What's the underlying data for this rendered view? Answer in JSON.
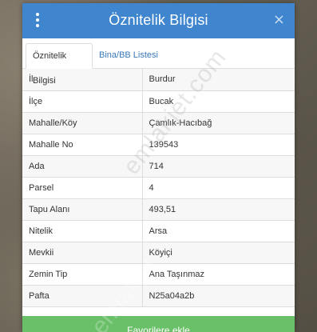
{
  "dialog": {
    "title": "Öznitelik Bilgisi",
    "close_glyph": "×"
  },
  "tabs": [
    {
      "label": "Öznitelik Bilgisi",
      "active": true
    },
    {
      "label": "Bina/BB Listesi",
      "active": false
    }
  ],
  "attributes": [
    {
      "key": "İl",
      "value": "Burdur"
    },
    {
      "key": "İlçe",
      "value": "Bucak"
    },
    {
      "key": "Mahalle/Köy",
      "value": "Çamlık-Hacıbağ"
    },
    {
      "key": "Mahalle No",
      "value": "139543"
    },
    {
      "key": "Ada",
      "value": "714"
    },
    {
      "key": "Parsel",
      "value": "4"
    },
    {
      "key": "Tapu Alanı",
      "value": "493,51"
    },
    {
      "key": "Nitelik",
      "value": "Arsa"
    },
    {
      "key": "Mevkii",
      "value": "Köyiçi"
    },
    {
      "key": "Zemin Tip",
      "value": "Ana Taşınmaz"
    },
    {
      "key": "Pafta",
      "value": "N25a04a2b"
    }
  ],
  "favorites_button": {
    "label": "Favorilere ekle"
  },
  "watermark": {
    "text": "emlakjet.com",
    "text2": "emlakjet"
  },
  "colors": {
    "header": "#3f86cf",
    "tab_link": "#3a78b8",
    "favorites": "#6abf69"
  },
  "icons": {
    "menu": "vertical-dots-icon",
    "close": "close-icon"
  }
}
